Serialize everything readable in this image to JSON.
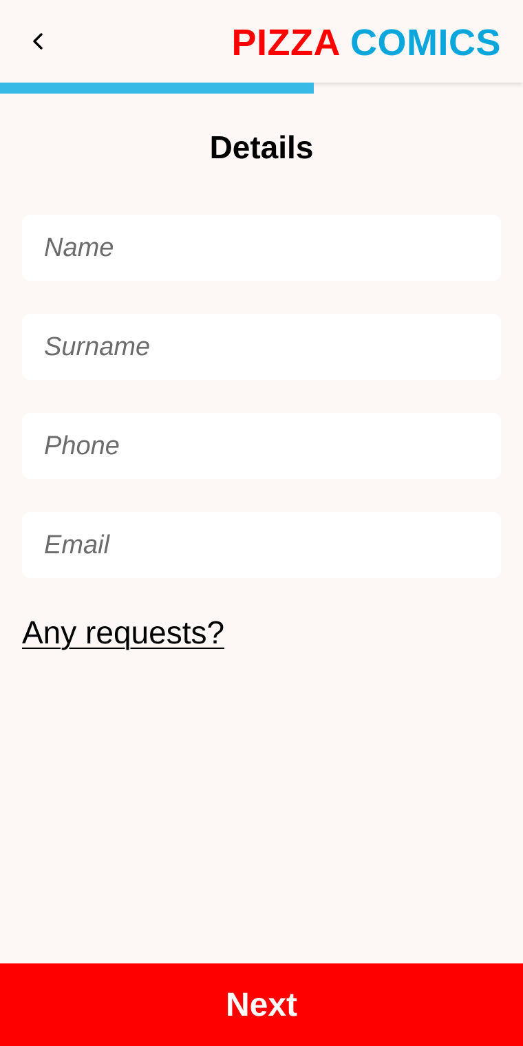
{
  "header": {
    "back_icon": "chevron-left-icon",
    "brand_word_1": "PIZZA",
    "brand_word_2": "COMICS",
    "brand_color_1": "#ff0000",
    "brand_color_2": "#0aa6dc"
  },
  "progress": {
    "fraction": 0.6,
    "color": "#37bbe6"
  },
  "page": {
    "title": "Details"
  },
  "form": {
    "name": {
      "value": "",
      "placeholder": "Name"
    },
    "surname": {
      "value": "",
      "placeholder": "Surname"
    },
    "phone": {
      "value": "",
      "placeholder": "Phone"
    },
    "email": {
      "value": "",
      "placeholder": "Email"
    },
    "requests_link": "Any requests?"
  },
  "footer": {
    "next_label": "Next",
    "next_color": "#ff0000"
  }
}
